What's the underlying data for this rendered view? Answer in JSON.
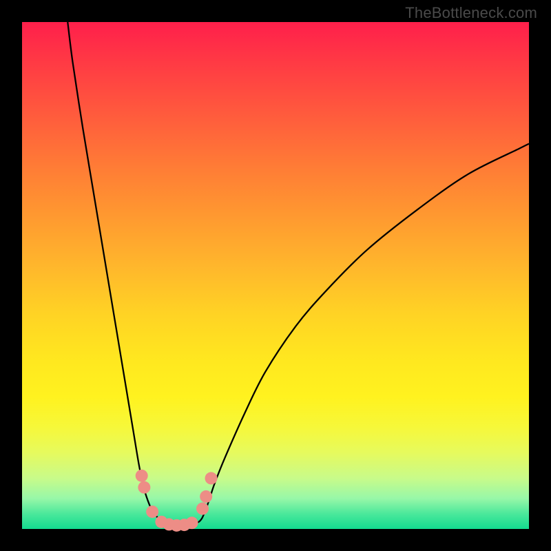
{
  "watermark": "TheBottleneck.com",
  "colors": {
    "frame": "#000000",
    "gradient_top": "#ff1f4b",
    "gradient_bottom": "#13db8f",
    "curve": "#000000",
    "dots": "#ed8d86"
  },
  "chart_data": {
    "type": "line",
    "title": "",
    "xlabel": "",
    "ylabel": "",
    "xlim": [
      0,
      100
    ],
    "ylim": [
      0,
      100
    ],
    "series": [
      {
        "name": "left-curve",
        "x": [
          9,
          10,
          12,
          14,
          16,
          18,
          19,
          20,
          21,
          22,
          23,
          23.8,
          24.5,
          25.5,
          27,
          29,
          31
        ],
        "y": [
          100,
          92,
          79,
          67,
          55,
          43,
          37,
          31,
          25,
          19,
          13,
          9,
          6.5,
          4,
          2,
          0.7,
          0.3
        ]
      },
      {
        "name": "right-curve",
        "x": [
          31,
          33,
          35,
          36,
          37,
          38,
          40,
          44,
          48,
          54,
          60,
          68,
          78,
          88,
          98,
          100
        ],
        "y": [
          0.3,
          0.7,
          1.5,
          3.2,
          6,
          9,
          14,
          23,
          31,
          40,
          47,
          55,
          63,
          70,
          75,
          76
        ]
      }
    ],
    "points": [
      {
        "name": "dot-left-a",
        "x": 23.6,
        "y": 10.5
      },
      {
        "name": "dot-left-b",
        "x": 24.1,
        "y": 8.2
      },
      {
        "name": "dot-left-c",
        "x": 25.7,
        "y": 3.4
      },
      {
        "name": "dot-bottom-a",
        "x": 27.5,
        "y": 1.4
      },
      {
        "name": "dot-bottom-b",
        "x": 29.0,
        "y": 0.9
      },
      {
        "name": "dot-bottom-c",
        "x": 30.5,
        "y": 0.7
      },
      {
        "name": "dot-bottom-d",
        "x": 32.0,
        "y": 0.8
      },
      {
        "name": "dot-bottom-e",
        "x": 33.5,
        "y": 1.2
      },
      {
        "name": "dot-right-a",
        "x": 35.6,
        "y": 4.0
      },
      {
        "name": "dot-right-b",
        "x": 36.3,
        "y": 6.4
      },
      {
        "name": "dot-right-c",
        "x": 37.3,
        "y": 10.0
      }
    ]
  }
}
